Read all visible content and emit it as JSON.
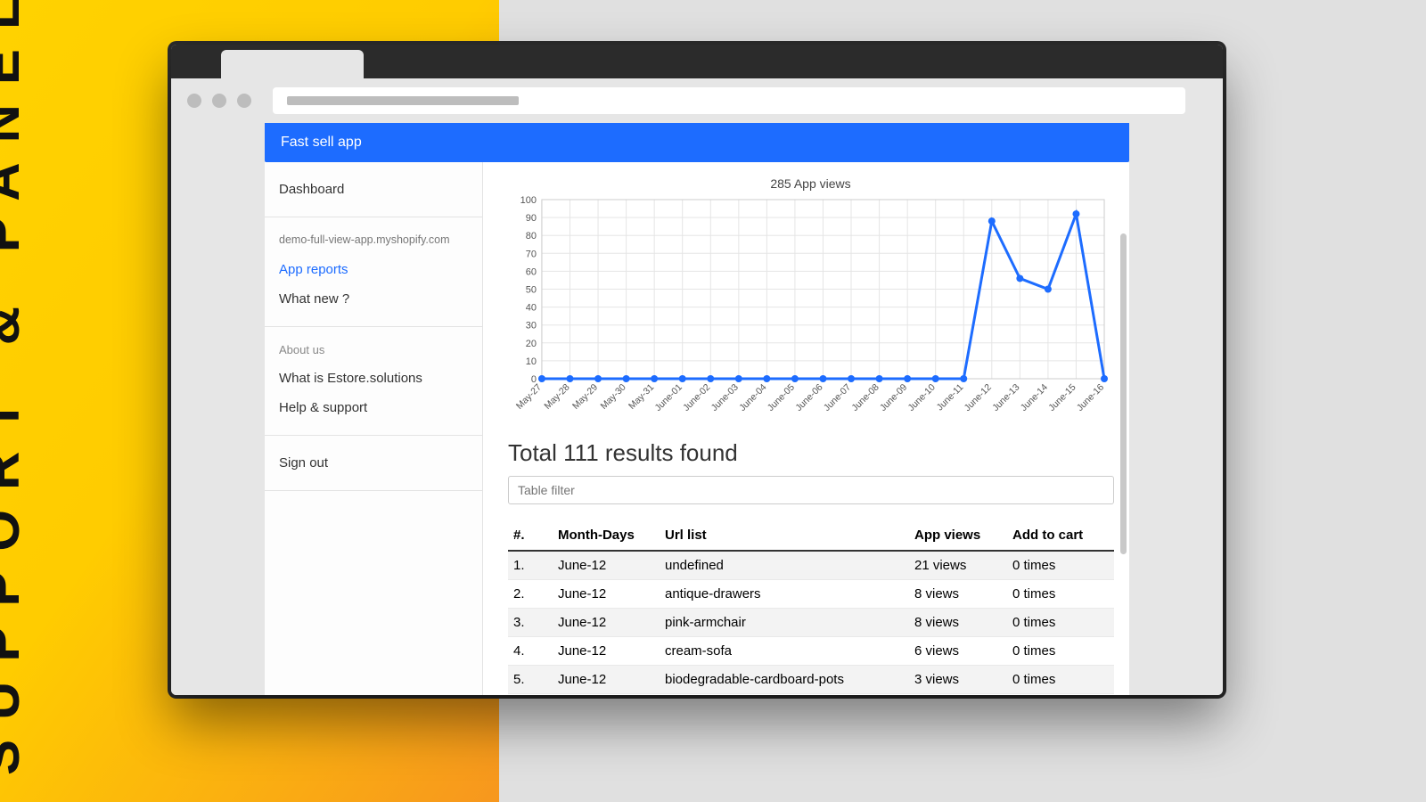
{
  "promo": {
    "side_label": "SUPPORT & PANEL"
  },
  "app": {
    "title": "Fast sell app",
    "sidebar": {
      "dashboard": "Dashboard",
      "shop_domain": "demo-full-view-app.myshopify.com",
      "app_reports": "App reports",
      "what_new": "What new ?",
      "about_heading": "About us",
      "what_is": "What is Estore.solutions",
      "help": "Help & support",
      "sign_out": "Sign out"
    }
  },
  "main": {
    "chart_title": "285 App views",
    "results_heading": "Total 111 results found",
    "filter_placeholder": "Table filter"
  },
  "table": {
    "headers": {
      "idx": "#.",
      "day": "Month-Days",
      "url": "Url list",
      "views": "App views",
      "cart": "Add to cart"
    },
    "rows": [
      {
        "idx": "1.",
        "day": "June-12",
        "url": "undefined",
        "views": "21 views",
        "cart": "0 times"
      },
      {
        "idx": "2.",
        "day": "June-12",
        "url": "antique-drawers",
        "views": "8 views",
        "cart": "0 times"
      },
      {
        "idx": "3.",
        "day": "June-12",
        "url": "pink-armchair",
        "views": "8 views",
        "cart": "0 times"
      },
      {
        "idx": "4.",
        "day": "June-12",
        "url": "cream-sofa",
        "views": "6 views",
        "cart": "0 times"
      },
      {
        "idx": "5.",
        "day": "June-12",
        "url": "biodegradable-cardboard-pots",
        "views": "3 views",
        "cart": "0 times"
      }
    ]
  },
  "chart_data": {
    "type": "line",
    "title": "285 App views",
    "xlabel": "",
    "ylabel": "",
    "ylim": [
      0,
      100
    ],
    "yticks": [
      0,
      10,
      20,
      30,
      40,
      50,
      60,
      70,
      80,
      90,
      100
    ],
    "categories": [
      "May-27",
      "May-28",
      "May-29",
      "May-30",
      "May-31",
      "June-01",
      "June-02",
      "June-03",
      "June-04",
      "June-05",
      "June-06",
      "June-07",
      "June-08",
      "June-09",
      "June-10",
      "June-11",
      "June-12",
      "June-13",
      "June-14",
      "June-15",
      "June-16"
    ],
    "values": [
      0,
      0,
      0,
      0,
      0,
      0,
      0,
      0,
      0,
      0,
      0,
      0,
      0,
      0,
      0,
      0,
      88,
      56,
      50,
      92,
      0
    ]
  }
}
